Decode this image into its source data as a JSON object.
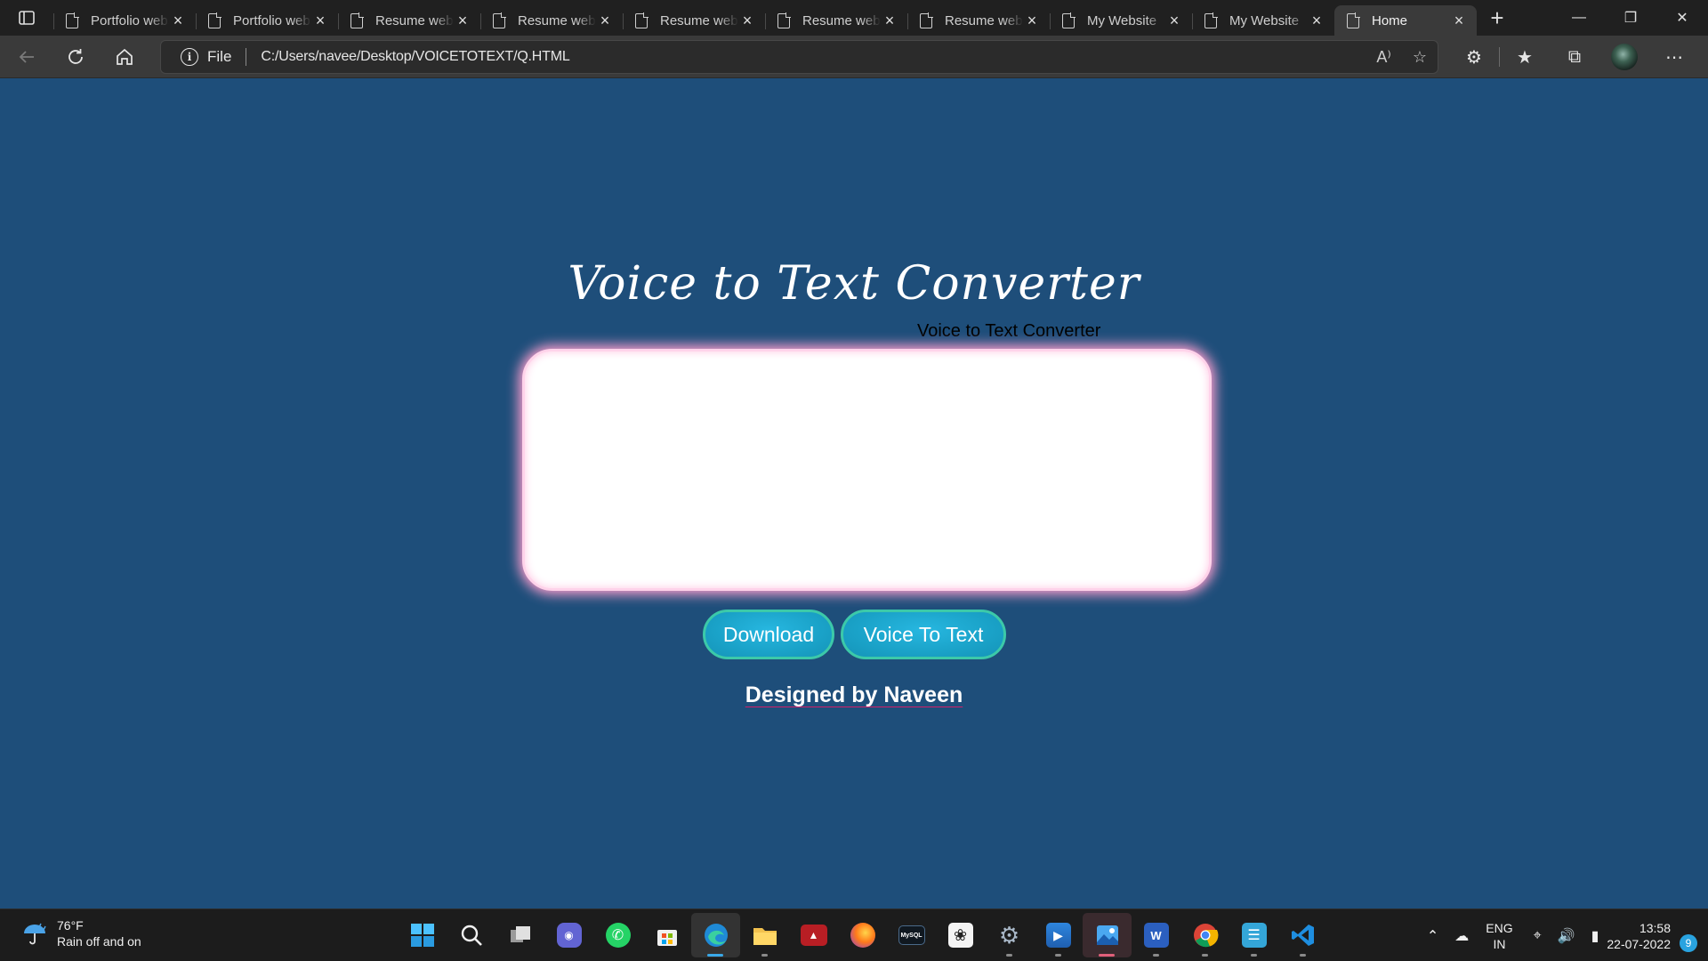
{
  "browser": {
    "tabs": [
      {
        "label": "Portfolio website"
      },
      {
        "label": "Portfolio website"
      },
      {
        "label": "Resume website"
      },
      {
        "label": "Resume website"
      },
      {
        "label": "Resume website"
      },
      {
        "label": "Resume website"
      },
      {
        "label": "Resume website"
      },
      {
        "label": "My Website"
      },
      {
        "label": "My Website"
      },
      {
        "label": "Home"
      }
    ],
    "active_tab_index": 9,
    "address": {
      "scheme_label": "File",
      "url": "C:/Users/navee/Desktop/VOICETOTEXT/Q.HTML"
    }
  },
  "page": {
    "title": "Voice to Text Converter",
    "subtitle": "Voice to Text Converter",
    "textarea_value": "",
    "buttons": {
      "download": "Download",
      "voice_to_text": "Voice To Text"
    },
    "credit": "Designed by Naveen",
    "background_color": "#1e4e7a",
    "accent_color": "#1aa2c8"
  },
  "taskbar": {
    "weather": {
      "temp": "76°F",
      "condition": "Rain off and on"
    },
    "apps": [
      "start-icon",
      "search-icon",
      "task-view-icon",
      "teams-chat-icon",
      "whatsapp-icon",
      "store-icon",
      "edge-icon",
      "file-explorer-icon",
      "mysql-workbench-icon",
      "firefox-icon",
      "mysql-shell-icon",
      "inkscape-icon",
      "settings-icon",
      "media-player-icon",
      "photos-icon",
      "word-icon",
      "chrome-icon",
      "notepad-icon",
      "vscode-icon"
    ],
    "language": {
      "line1": "ENG",
      "line2": "IN"
    },
    "clock": {
      "time": "13:58",
      "date": "22-07-2022"
    },
    "notification_count": "9"
  }
}
